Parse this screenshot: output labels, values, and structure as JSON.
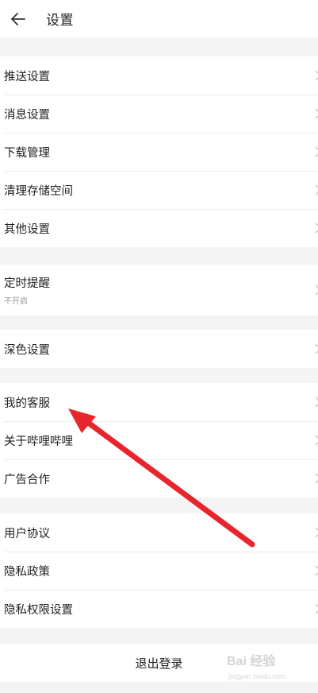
{
  "header": {
    "title": "设置",
    "back_icon": "arrow-left-icon"
  },
  "groups": [
    {
      "items": [
        {
          "label": "推送设置"
        },
        {
          "label": "消息设置"
        },
        {
          "label": "下载管理"
        },
        {
          "label": "清理存储空间"
        },
        {
          "label": "其他设置"
        }
      ]
    },
    {
      "items": [
        {
          "label": "定时提醒",
          "sub": "不开启"
        }
      ]
    },
    {
      "items": [
        {
          "label": "深色设置"
        }
      ]
    },
    {
      "items": [
        {
          "label": "我的客服"
        },
        {
          "label": "关于哔哩哔哩"
        },
        {
          "label": "广告合作"
        }
      ]
    },
    {
      "items": [
        {
          "label": "用户协议"
        },
        {
          "label": "隐私政策"
        },
        {
          "label": "隐私权限设置"
        }
      ]
    }
  ],
  "logout": {
    "label": "退出登录"
  },
  "annotation": {
    "arrow_color": "#e8242d"
  },
  "watermark": {
    "text": "Bai 经验",
    "sub": "jingyan.baidu.com"
  },
  "colors": {
    "background": "#f4f4f4",
    "surface": "#ffffff",
    "divider": "#ececec",
    "text": "#222222",
    "subtext": "#999999"
  }
}
